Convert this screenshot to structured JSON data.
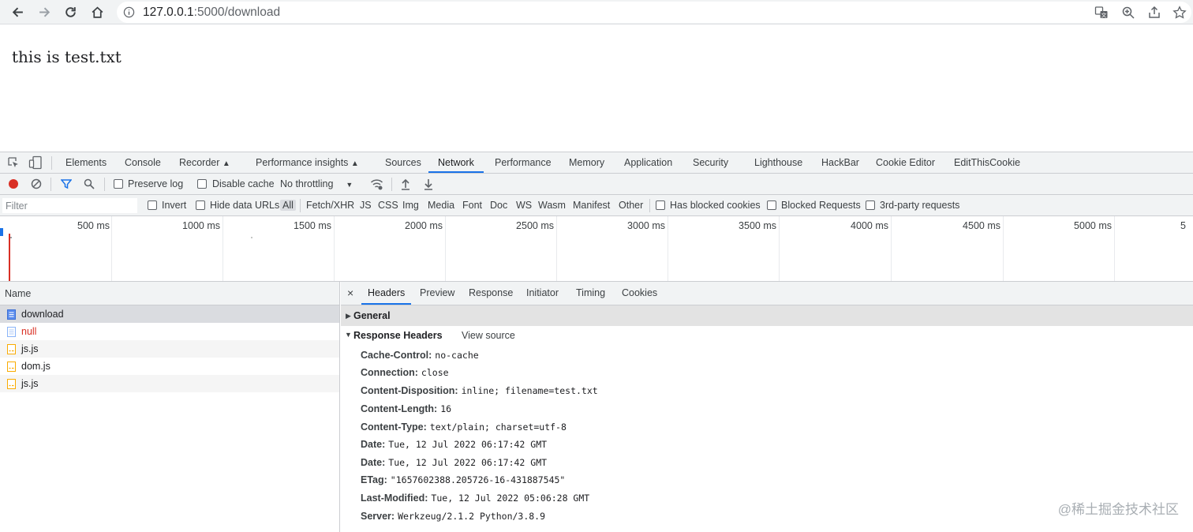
{
  "browser": {
    "url_host": "127.0.0.1",
    "url_rest": ":5000/download"
  },
  "page": {
    "text": "this is test.txt"
  },
  "devtools": {
    "tabs": [
      "Elements",
      "Console",
      "Recorder",
      "Performance insights",
      "Sources",
      "Network",
      "Performance",
      "Memory",
      "Application",
      "Security",
      "Lighthouse",
      "HackBar",
      "Cookie Editor",
      "EditThisCookie"
    ],
    "active_tab": "Network",
    "toolbar": {
      "preserve_log": "Preserve log",
      "disable_cache": "Disable cache",
      "throttling": "No throttling"
    },
    "filterbar": {
      "filter_placeholder": "Filter",
      "invert": "Invert",
      "hide_data_urls": "Hide data URLs",
      "types": [
        "All",
        "Fetch/XHR",
        "JS",
        "CSS",
        "Img",
        "Media",
        "Font",
        "Doc",
        "WS",
        "Wasm",
        "Manifest",
        "Other"
      ],
      "has_blocked_cookies": "Has blocked cookies",
      "blocked_requests": "Blocked Requests",
      "third_party": "3rd-party requests"
    },
    "overview_labels": [
      "500 ms",
      "1000 ms",
      "1500 ms",
      "2000 ms",
      "2500 ms",
      "3000 ms",
      "3500 ms",
      "4000 ms",
      "4500 ms",
      "5000 ms",
      "5"
    ],
    "request_list": {
      "header": "Name",
      "rows": [
        {
          "name": "download",
          "icon": "document-icon",
          "status": "selected"
        },
        {
          "name": "null",
          "icon": "document-icon",
          "status": "error"
        },
        {
          "name": "js.js",
          "icon": "script-icon",
          "status": "ok"
        },
        {
          "name": "dom.js",
          "icon": "script-icon",
          "status": "ok"
        },
        {
          "name": "js.js",
          "icon": "script-icon",
          "status": "ok"
        }
      ]
    },
    "details": {
      "close": "×",
      "tabs": [
        "Headers",
        "Preview",
        "Response",
        "Initiator",
        "Timing",
        "Cookies"
      ],
      "active_tab": "Headers",
      "general": "General",
      "response_headers_title": "Response Headers",
      "view_source": "View source",
      "response_headers": [
        {
          "name": "Cache-Control:",
          "value": "no-cache"
        },
        {
          "name": "Connection:",
          "value": "close"
        },
        {
          "name": "Content-Disposition:",
          "value": "inline; filename=test.txt"
        },
        {
          "name": "Content-Length:",
          "value": "16"
        },
        {
          "name": "Content-Type:",
          "value": "text/plain; charset=utf-8"
        },
        {
          "name": "Date:",
          "value": "Tue, 12 Jul 2022 06:17:42 GMT"
        },
        {
          "name": "Date:",
          "value": "Tue, 12 Jul 2022 06:17:42 GMT"
        },
        {
          "name": "ETag:",
          "value": "\"1657602388.205726-16-431887545\""
        },
        {
          "name": "Last-Modified:",
          "value": "Tue, 12 Jul 2022 05:06:28 GMT"
        },
        {
          "name": "Server:",
          "value": "Werkzeug/2.1.2 Python/3.8.9"
        }
      ]
    }
  },
  "watermark": "@稀土掘金技术社区",
  "colors": {
    "accent": "#1a73e8",
    "record": "#d93025",
    "error_text": "#d93025"
  }
}
